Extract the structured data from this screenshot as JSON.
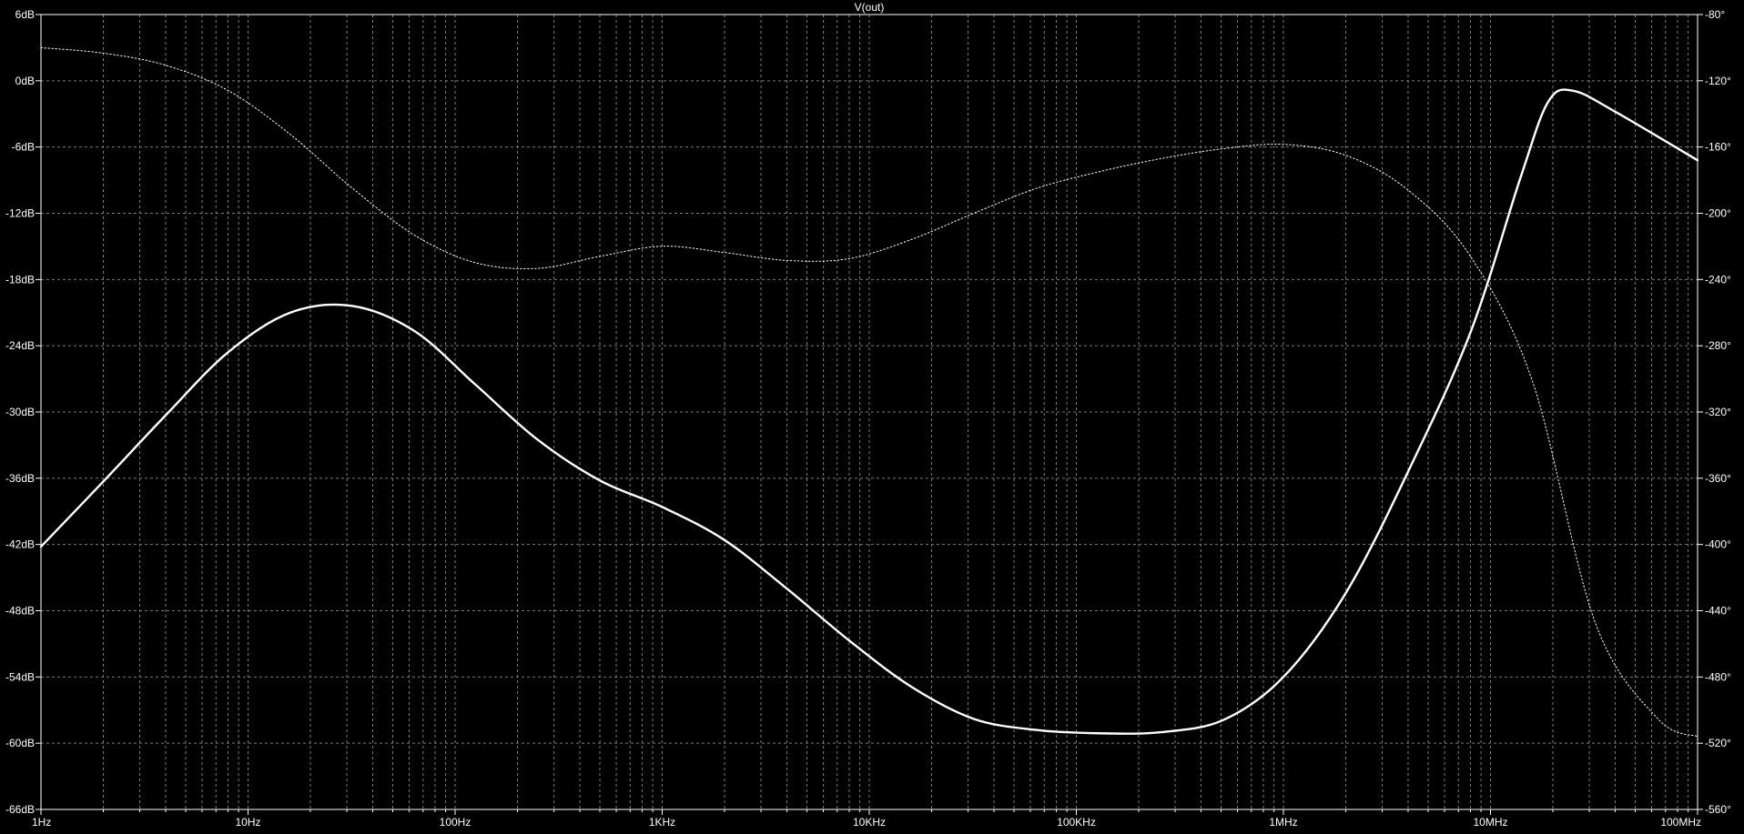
{
  "chart_data": {
    "type": "line",
    "title": "V(out)",
    "x_scale": "log",
    "xlim": [
      1,
      100000000
    ],
    "ylim_left": [
      -66,
      6
    ],
    "ylim_right": [
      -560,
      -80
    ],
    "grid": true,
    "x_ticks": [
      {
        "value": 1,
        "label": "1Hz"
      },
      {
        "value": 10,
        "label": "10Hz"
      },
      {
        "value": 100,
        "label": "100Hz"
      },
      {
        "value": 1000,
        "label": "1KHz"
      },
      {
        "value": 10000,
        "label": "10KHz"
      },
      {
        "value": 100000,
        "label": "100KHz"
      },
      {
        "value": 1000000,
        "label": "1MHz"
      },
      {
        "value": 10000000,
        "label": "10MHz"
      },
      {
        "value": 100000000,
        "label": "100MHz"
      }
    ],
    "y_ticks_left": [
      {
        "value": 6,
        "label": "6dB"
      },
      {
        "value": 0,
        "label": "0dB"
      },
      {
        "value": -6,
        "label": "-6dB"
      },
      {
        "value": -12,
        "label": "-12dB"
      },
      {
        "value": -18,
        "label": "-18dB"
      },
      {
        "value": -24,
        "label": "-24dB"
      },
      {
        "value": -30,
        "label": "-30dB"
      },
      {
        "value": -36,
        "label": "-36dB"
      },
      {
        "value": -42,
        "label": "-42dB"
      },
      {
        "value": -48,
        "label": "-48dB"
      },
      {
        "value": -54,
        "label": "-54dB"
      },
      {
        "value": -60,
        "label": "-60dB"
      },
      {
        "value": -66,
        "label": "-66dB"
      }
    ],
    "y_ticks_right": [
      {
        "value": -80,
        "label": "-80°"
      },
      {
        "value": -120,
        "label": "-120°"
      },
      {
        "value": -160,
        "label": "-160°"
      },
      {
        "value": -200,
        "label": "-200°"
      },
      {
        "value": -240,
        "label": "-240°"
      },
      {
        "value": -280,
        "label": "-280°"
      },
      {
        "value": -320,
        "label": "-320°"
      },
      {
        "value": -360,
        "label": "-360°"
      },
      {
        "value": -400,
        "label": "-400°"
      },
      {
        "value": -440,
        "label": "-440°"
      },
      {
        "value": -480,
        "label": "-480°"
      },
      {
        "value": -520,
        "label": "-520°"
      },
      {
        "value": -560,
        "label": "-560°"
      }
    ],
    "series": [
      {
        "axis": "left",
        "style": "solid",
        "color": "#ffffff",
        "x": [
          1,
          2,
          4,
          8,
          16,
          32,
          64,
          125,
          250,
          500,
          1000,
          2000,
          4000,
          8000,
          16000,
          32000,
          64000,
          128000,
          256000,
          512000,
          1000000,
          2000000,
          4000000,
          8000000,
          14000000,
          19000000,
          25000000,
          40000000,
          100000000
        ],
        "y": [
          -42.2,
          -36.3,
          -30.3,
          -24.6,
          -21.0,
          -20.4,
          -22.7,
          -27.5,
          -32.5,
          -36.2,
          -38.6,
          -41.6,
          -46.0,
          -50.7,
          -54.9,
          -57.8,
          -58.8,
          -59.1,
          -59.0,
          -57.9,
          -54.0,
          -46.4,
          -35.4,
          -22.8,
          -8.7,
          -1.9,
          -0.9,
          -2.8,
          -7.2
        ]
      },
      {
        "axis": "right",
        "style": "dotted",
        "color": "#ffffff",
        "x": [
          1,
          2,
          4,
          8,
          16,
          32,
          64,
          125,
          250,
          500,
          1000,
          2000,
          4000,
          8000,
          16000,
          32000,
          64000,
          128000,
          256000,
          512000,
          1000000,
          2000000,
          4000000,
          8000000,
          16000000,
          32000000,
          64000000,
          100000000
        ],
        "y": [
          -100.0,
          -103.3,
          -110.6,
          -125.8,
          -152.4,
          -185.0,
          -213.4,
          -229.8,
          -233.3,
          -226.0,
          -219.9,
          -223.7,
          -228.5,
          -227.4,
          -215.8,
          -200.0,
          -185.0,
          -175.0,
          -167.0,
          -161.0,
          -158.4,
          -165.0,
          -186.0,
          -226.0,
          -302.0,
          -447.0,
          -505.0,
          -516.0
        ]
      }
    ]
  }
}
